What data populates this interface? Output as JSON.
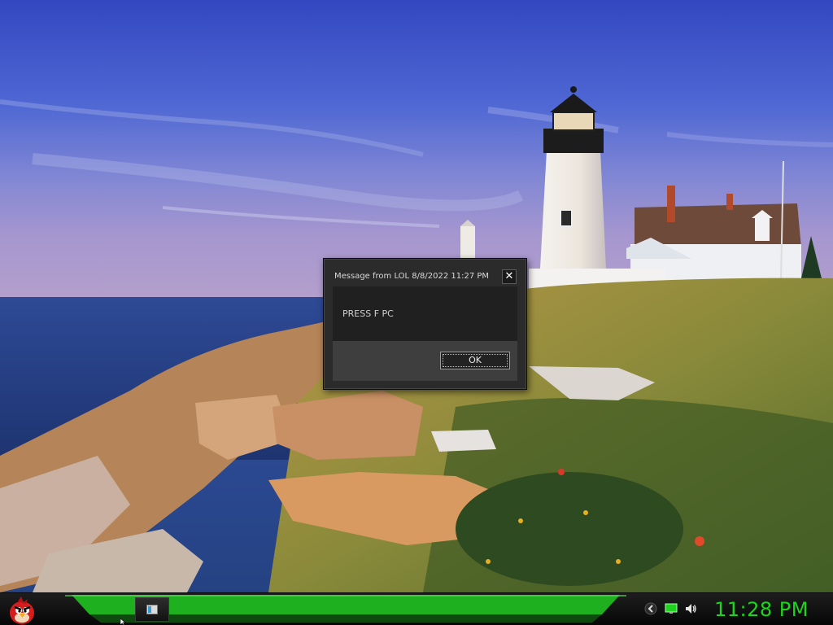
{
  "dialog": {
    "title": "Message from LOL 8/8/2022 11:27 PM",
    "close_label": "✕",
    "message": "PRESS F PC",
    "ok_label": "OK"
  },
  "taskbar": {
    "start_icon": "angry-bird-icon",
    "task_item_icon": "window-icon",
    "tray_icons": [
      "chevron-left-icon",
      "monitor-icon",
      "speaker-icon"
    ],
    "clock": "11:28 PM",
    "clock_color": "#1fd41f",
    "bar_color": "#1fb01f"
  },
  "wallpaper": {
    "subject": "lighthouse"
  }
}
